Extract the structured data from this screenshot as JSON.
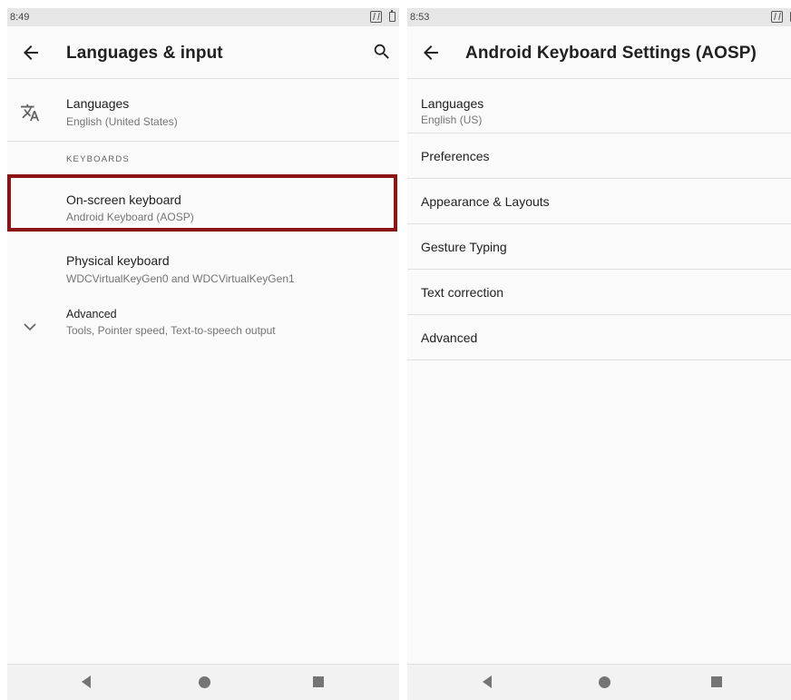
{
  "left": {
    "status": {
      "time": "8:49"
    },
    "header": {
      "title": "Languages & input"
    },
    "languages": {
      "title": "Languages",
      "subtitle": "English (United States)"
    },
    "section": {
      "keyboards_header": "KEYBOARDS"
    },
    "on_screen_keyboard": {
      "title": "On-screen keyboard",
      "subtitle": "Android Keyboard (AOSP)"
    },
    "physical_keyboard": {
      "title": "Physical keyboard",
      "subtitle": "WDCVirtualKeyGen0 and WDCVirtualKeyGen1"
    },
    "advanced": {
      "title": "Advanced",
      "subtitle": "Tools, Pointer speed, Text-to-speech output"
    }
  },
  "right": {
    "status": {
      "time": "8:53"
    },
    "header": {
      "title": "Android Keyboard Settings (AOSP)"
    },
    "languages": {
      "title": "Languages",
      "subtitle": "English (US)"
    },
    "items": [
      {
        "label": "Preferences"
      },
      {
        "label": "Appearance & Layouts"
      },
      {
        "label": "Gesture Typing"
      },
      {
        "label": "Text correction"
      },
      {
        "label": "Advanced"
      }
    ]
  },
  "colors": {
    "highlight": "#8b1414",
    "background": "#fafafa",
    "statusbar": "#e6e6e6"
  },
  "icons": [
    "back-arrow-icon",
    "search-icon",
    "translate-icon",
    "chevron-down-icon",
    "nfc-icon",
    "battery-icon",
    "nav-back-icon",
    "nav-home-icon",
    "nav-recents-icon"
  ]
}
